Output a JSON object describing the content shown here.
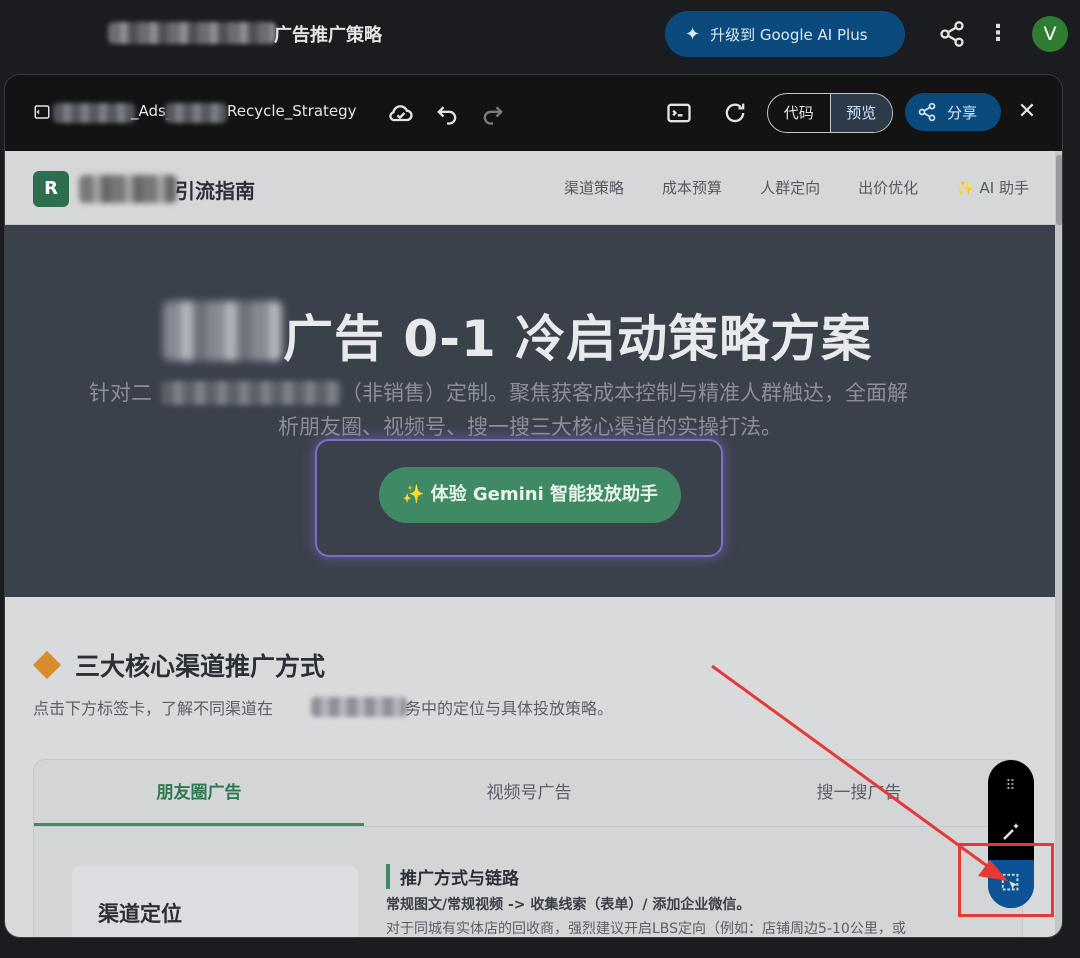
{
  "app": {
    "top_title": "广告推广策略",
    "upgrade_label": "升级到 Google AI Plus",
    "avatar_initial": "V"
  },
  "canvas": {
    "file_name_part1": "_Ads_",
    "file_name_part2": "Recycle_Strategy",
    "view_toggle": {
      "code_label": "代码",
      "preview_label": "预览",
      "selected": "预览"
    },
    "share_label": "分享",
    "close_glyph": "✕"
  },
  "site": {
    "logo_letter": "R",
    "logo_text": "引流指南",
    "nav": [
      "渠道策略",
      "成本预算",
      "人群定向",
      "出价优化",
      "✨ AI 助手"
    ],
    "hero": {
      "title": "广告 0-1 冷启动策略方案",
      "subtitle_part1": "针对二",
      "subtitle_part2": "（非销售）定制。聚焦获客成本控制与精准人群触达，全面解",
      "subtitle_line2": "析朋友圈、视频号、搜一搜三大核心渠道的实操打法。",
      "cta_label": "✨ 体验 Gemini 智能投放助手"
    },
    "section": {
      "title": "三大核心渠道推广方式",
      "desc_part1": "点击下方标签卡，了解不同渠道在",
      "desc_part2": "务中的定位与具体投放策略。"
    },
    "tabs": [
      {
        "label": "朋友圈广告",
        "active": true
      },
      {
        "label": "视频号广告",
        "active": false
      },
      {
        "label": "搜一搜广告",
        "active": false
      }
    ],
    "panel": {
      "position_title": "渠道定位",
      "detail_title": "推广方式与链路",
      "detail_line1": "常规图文/常规视频 -> 收集线索（表单）/ 添加企业微信。",
      "detail_line2": "对于同城有实体店的回收商，强烈建议开启LBS定向（例如：店铺周边5-10公里，或"
    }
  },
  "fab": {
    "dots": "⠿"
  },
  "colors": {
    "brand_green": "#3f8a65",
    "upgrade_blue": "#0b4a7c",
    "hero_bg": "#3a414b",
    "annotation_red": "#e53935",
    "highlight_purple": "#7a6fc9"
  }
}
